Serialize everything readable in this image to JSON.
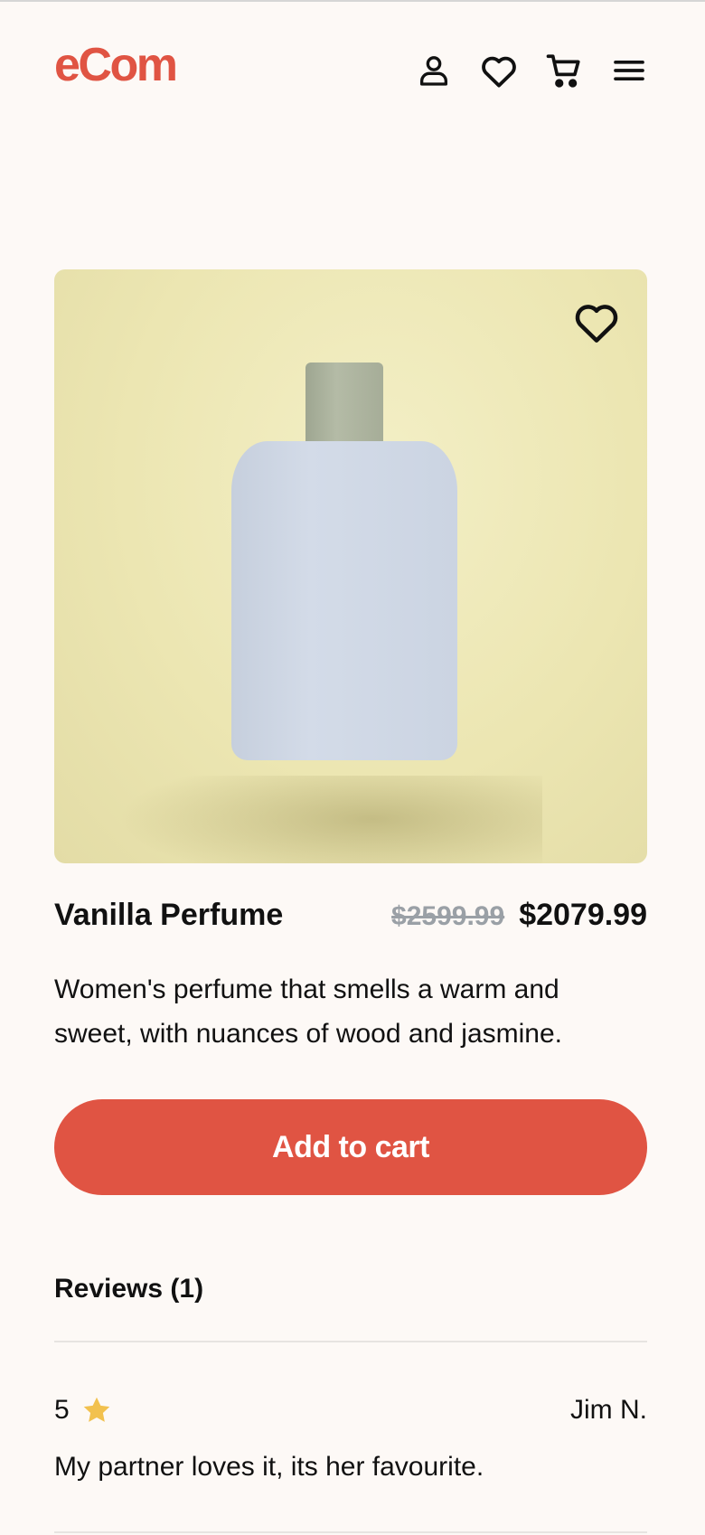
{
  "header": {
    "logo": "eCom",
    "icons": [
      "user-icon",
      "heart-icon",
      "cart-icon",
      "menu-icon"
    ]
  },
  "product": {
    "name": "Vanilla Perfume",
    "old_price": "$2599.99",
    "price": "$2079.99",
    "description": "Women's perfume that smells a warm and sweet, with nuances of wood and jasmine.",
    "add_to_cart_label": "Add to cart"
  },
  "reviews": {
    "heading": "Reviews (1)",
    "items": [
      {
        "rating": "5",
        "author": "Jim N.",
        "text": "My partner loves it, its her favourite."
      }
    ]
  },
  "colors": {
    "brand": "#e05443",
    "background": "#fdf9f6",
    "star": "#f2c14e",
    "old_price": "#9aa0a6"
  }
}
